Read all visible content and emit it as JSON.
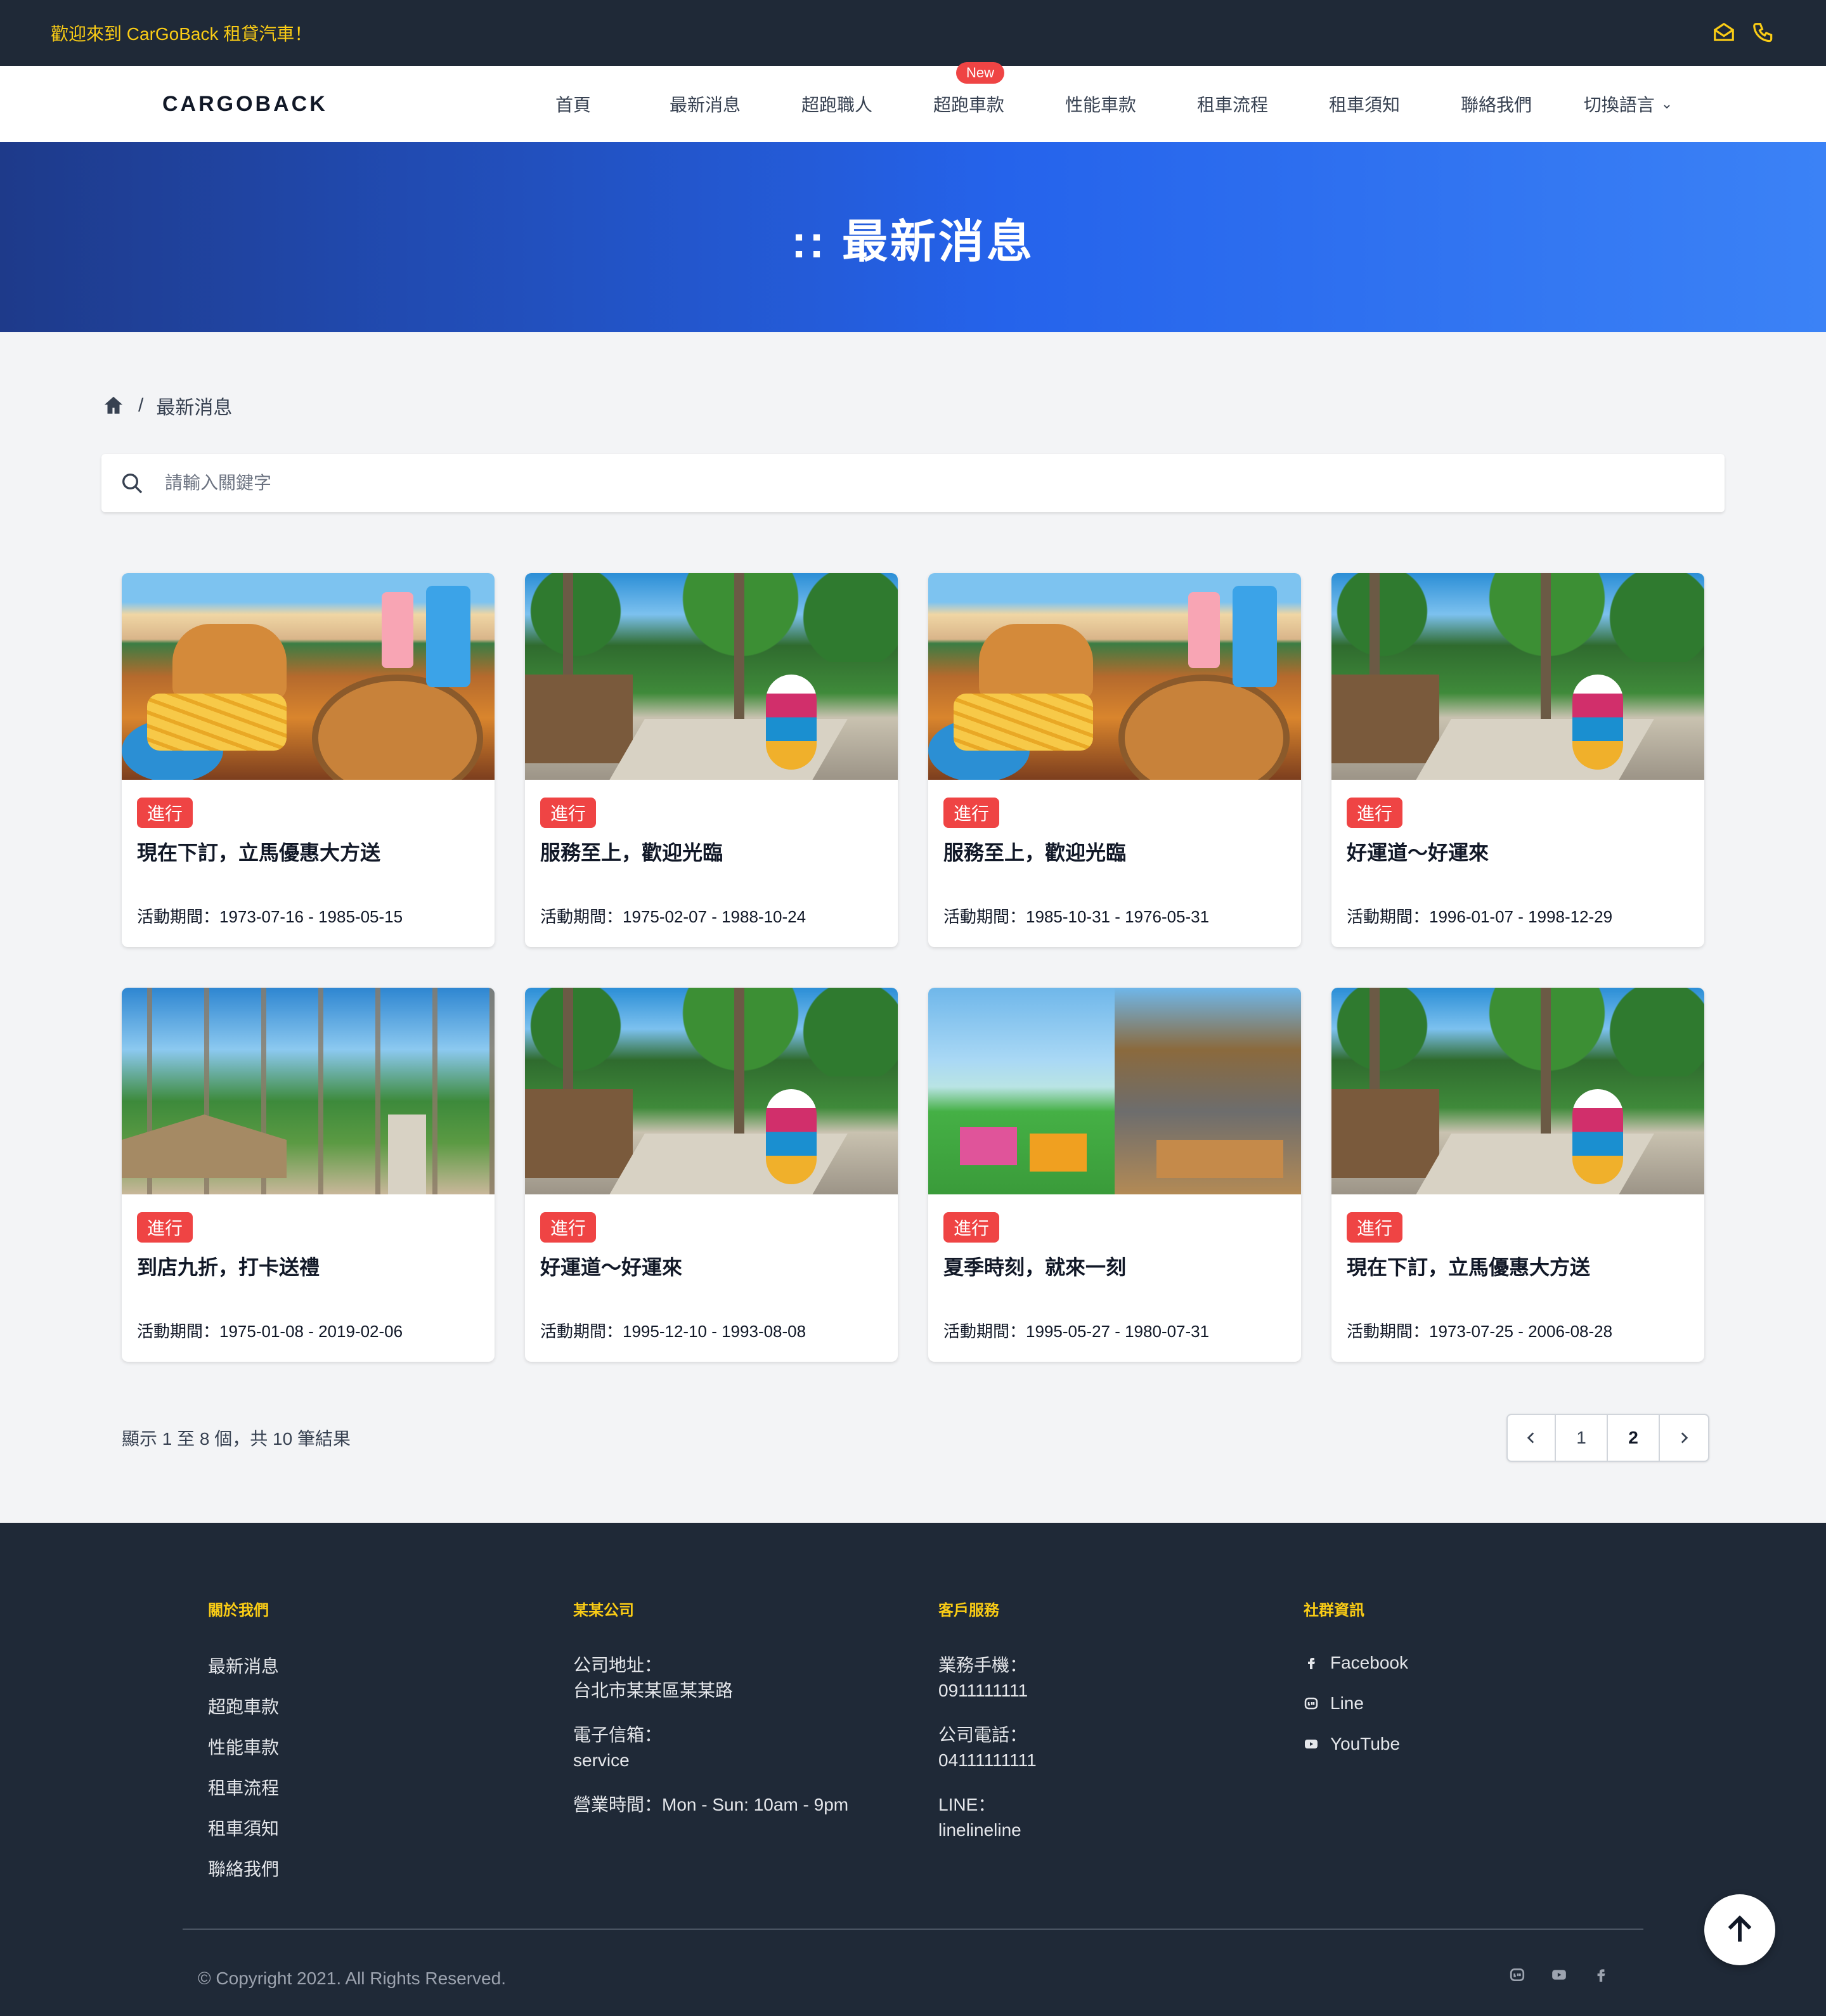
{
  "topbar": {
    "welcome": "歡迎來到 CarGoBack 租貸汽車！",
    "icons": [
      "mail-icon",
      "phone-icon"
    ]
  },
  "nav": {
    "logo": "CARGOBACK",
    "items": [
      {
        "label": "首頁"
      },
      {
        "label": "最新消息"
      },
      {
        "label": "超跑職人"
      },
      {
        "label": "超跑車款",
        "badge": "New"
      },
      {
        "label": "性能車款"
      },
      {
        "label": "租車流程"
      },
      {
        "label": "租車須知"
      },
      {
        "label": "聯絡我們"
      },
      {
        "label": "切換語言"
      }
    ]
  },
  "hero": {
    "title": ":: 最新消息"
  },
  "breadcrumb": {
    "current": "最新消息"
  },
  "search": {
    "placeholder": "請輸入關鍵字"
  },
  "cards": [
    {
      "image": "food",
      "tag": "進行",
      "title": "現在下訂，立馬優惠大方送",
      "period": "活動期間：1973-07-16 - 1985-05-15"
    },
    {
      "image": "resort",
      "tag": "進行",
      "title": "服務至上，歡迎光臨",
      "period": "活動期間：1975-02-07 - 1988-10-24"
    },
    {
      "image": "food",
      "tag": "進行",
      "title": "服務至上，歡迎光臨",
      "period": "活動期間：1985-10-31 - 1976-05-31"
    },
    {
      "image": "resort",
      "tag": "進行",
      "title": "好運道～好運來",
      "period": "活動期間：1996-01-07 - 1998-12-29"
    },
    {
      "image": "palms",
      "tag": "進行",
      "title": "到店九折，打卡送禮",
      "period": "活動期間：1975-01-08 - 2019-02-06"
    },
    {
      "image": "resort",
      "tag": "進行",
      "title": "好運道～好運來",
      "period": "活動期間：1995-12-10 - 1993-08-08"
    },
    {
      "image": "beach",
      "tag": "進行",
      "title": "夏季時刻，就來一刻",
      "period": "活動期間：1995-05-27 - 1980-07-31"
    },
    {
      "image": "resort",
      "tag": "進行",
      "title": "現在下訂，立馬優惠大方送",
      "period": "活動期間：1973-07-25 - 2006-08-28"
    }
  ],
  "pagination": {
    "summary": "顯示 1 至 8 個，共 10 筆結果",
    "pages": [
      "1",
      "2"
    ]
  },
  "footer": {
    "about": {
      "heading": "關於我們",
      "links": [
        "最新消息",
        "超跑車款",
        "性能車款",
        "租車流程",
        "租車須知",
        "聯絡我們"
      ]
    },
    "company": {
      "heading": "某某公司",
      "address_label": "公司地址：",
      "address": "台北市某某區某某路",
      "email_label": "電子信箱：",
      "email": "service",
      "hours": "營業時間：Mon - Sun: 10am - 9pm"
    },
    "service": {
      "heading": "客戶服務",
      "mobile_label": "業務手機：",
      "mobile": "0911111111",
      "phone_label": "公司電話：",
      "phone": "04111111111",
      "line_label": "LINE：",
      "line": "linelineline"
    },
    "social": {
      "heading": "社群資訊",
      "links": [
        "Facebook",
        "Line",
        "YouTube"
      ]
    },
    "copyright": "© Copyright 2021. All Rights Reserved."
  },
  "colors": {
    "accent": "#ef4444",
    "yellow": "#facc15",
    "dark": "#1f2937",
    "hero_start": "#1e3a8a",
    "hero_end": "#3b82f6"
  }
}
